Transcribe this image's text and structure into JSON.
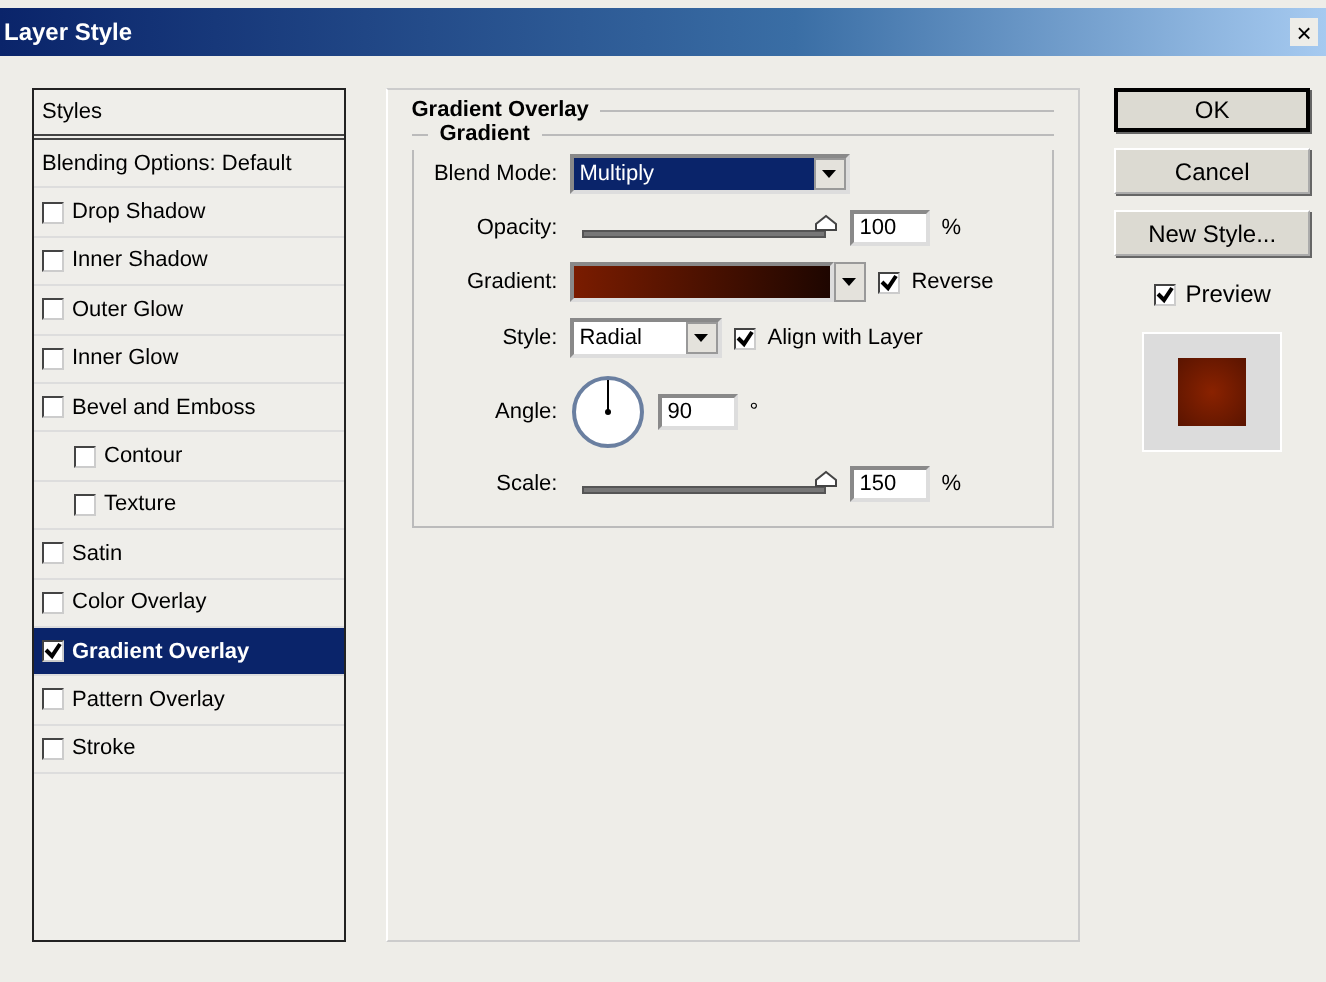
{
  "window": {
    "title": "Layer Style",
    "close": "×"
  },
  "styles_list": {
    "header": "Styles",
    "blending": {
      "label": "Blending Options: Default",
      "selected": false
    },
    "effects": [
      {
        "label": "Drop Shadow",
        "checked": false,
        "selected": false
      },
      {
        "label": "Inner Shadow",
        "checked": false,
        "selected": false
      },
      {
        "label": "Outer Glow",
        "checked": false,
        "selected": false
      },
      {
        "label": "Inner Glow",
        "checked": false,
        "selected": false
      },
      {
        "label": "Bevel and Emboss",
        "checked": false,
        "selected": false,
        "children": [
          {
            "label": "Contour",
            "checked": false,
            "selected": false
          },
          {
            "label": "Texture",
            "checked": false,
            "selected": false
          }
        ]
      },
      {
        "label": "Satin",
        "checked": false,
        "selected": false
      },
      {
        "label": "Color Overlay",
        "checked": false,
        "selected": false
      },
      {
        "label": "Gradient Overlay",
        "checked": true,
        "selected": true
      },
      {
        "label": "Pattern Overlay",
        "checked": false,
        "selected": false
      },
      {
        "label": "Stroke",
        "checked": false,
        "selected": false
      }
    ]
  },
  "panel": {
    "title": "Gradient Overlay",
    "group": "Gradient",
    "blend_mode": {
      "label": "Blend Mode:",
      "value": "Multiply"
    },
    "opacity": {
      "label": "Opacity:",
      "level": 1,
      "value": "100",
      "unit": "%"
    },
    "gradient": {
      "label": "Gradient:"
    },
    "reverse": {
      "label": "Reverse",
      "checked": true
    },
    "style": {
      "label": "Style:",
      "value": "Radial"
    },
    "align": {
      "label": "Align with Layer",
      "checked": true
    },
    "angle": {
      "label": "Angle:",
      "value": "90",
      "unit": "°"
    },
    "scale": {
      "label": "Scale:",
      "level": 1,
      "value": "150",
      "unit": "%"
    }
  },
  "buttons": [
    {
      "label": "OK",
      "default": true
    },
    {
      "label": "Cancel",
      "default": false
    },
    {
      "label": "New Style...",
      "default": false
    }
  ],
  "preview": {
    "label": "Preview",
    "checked": true
  }
}
